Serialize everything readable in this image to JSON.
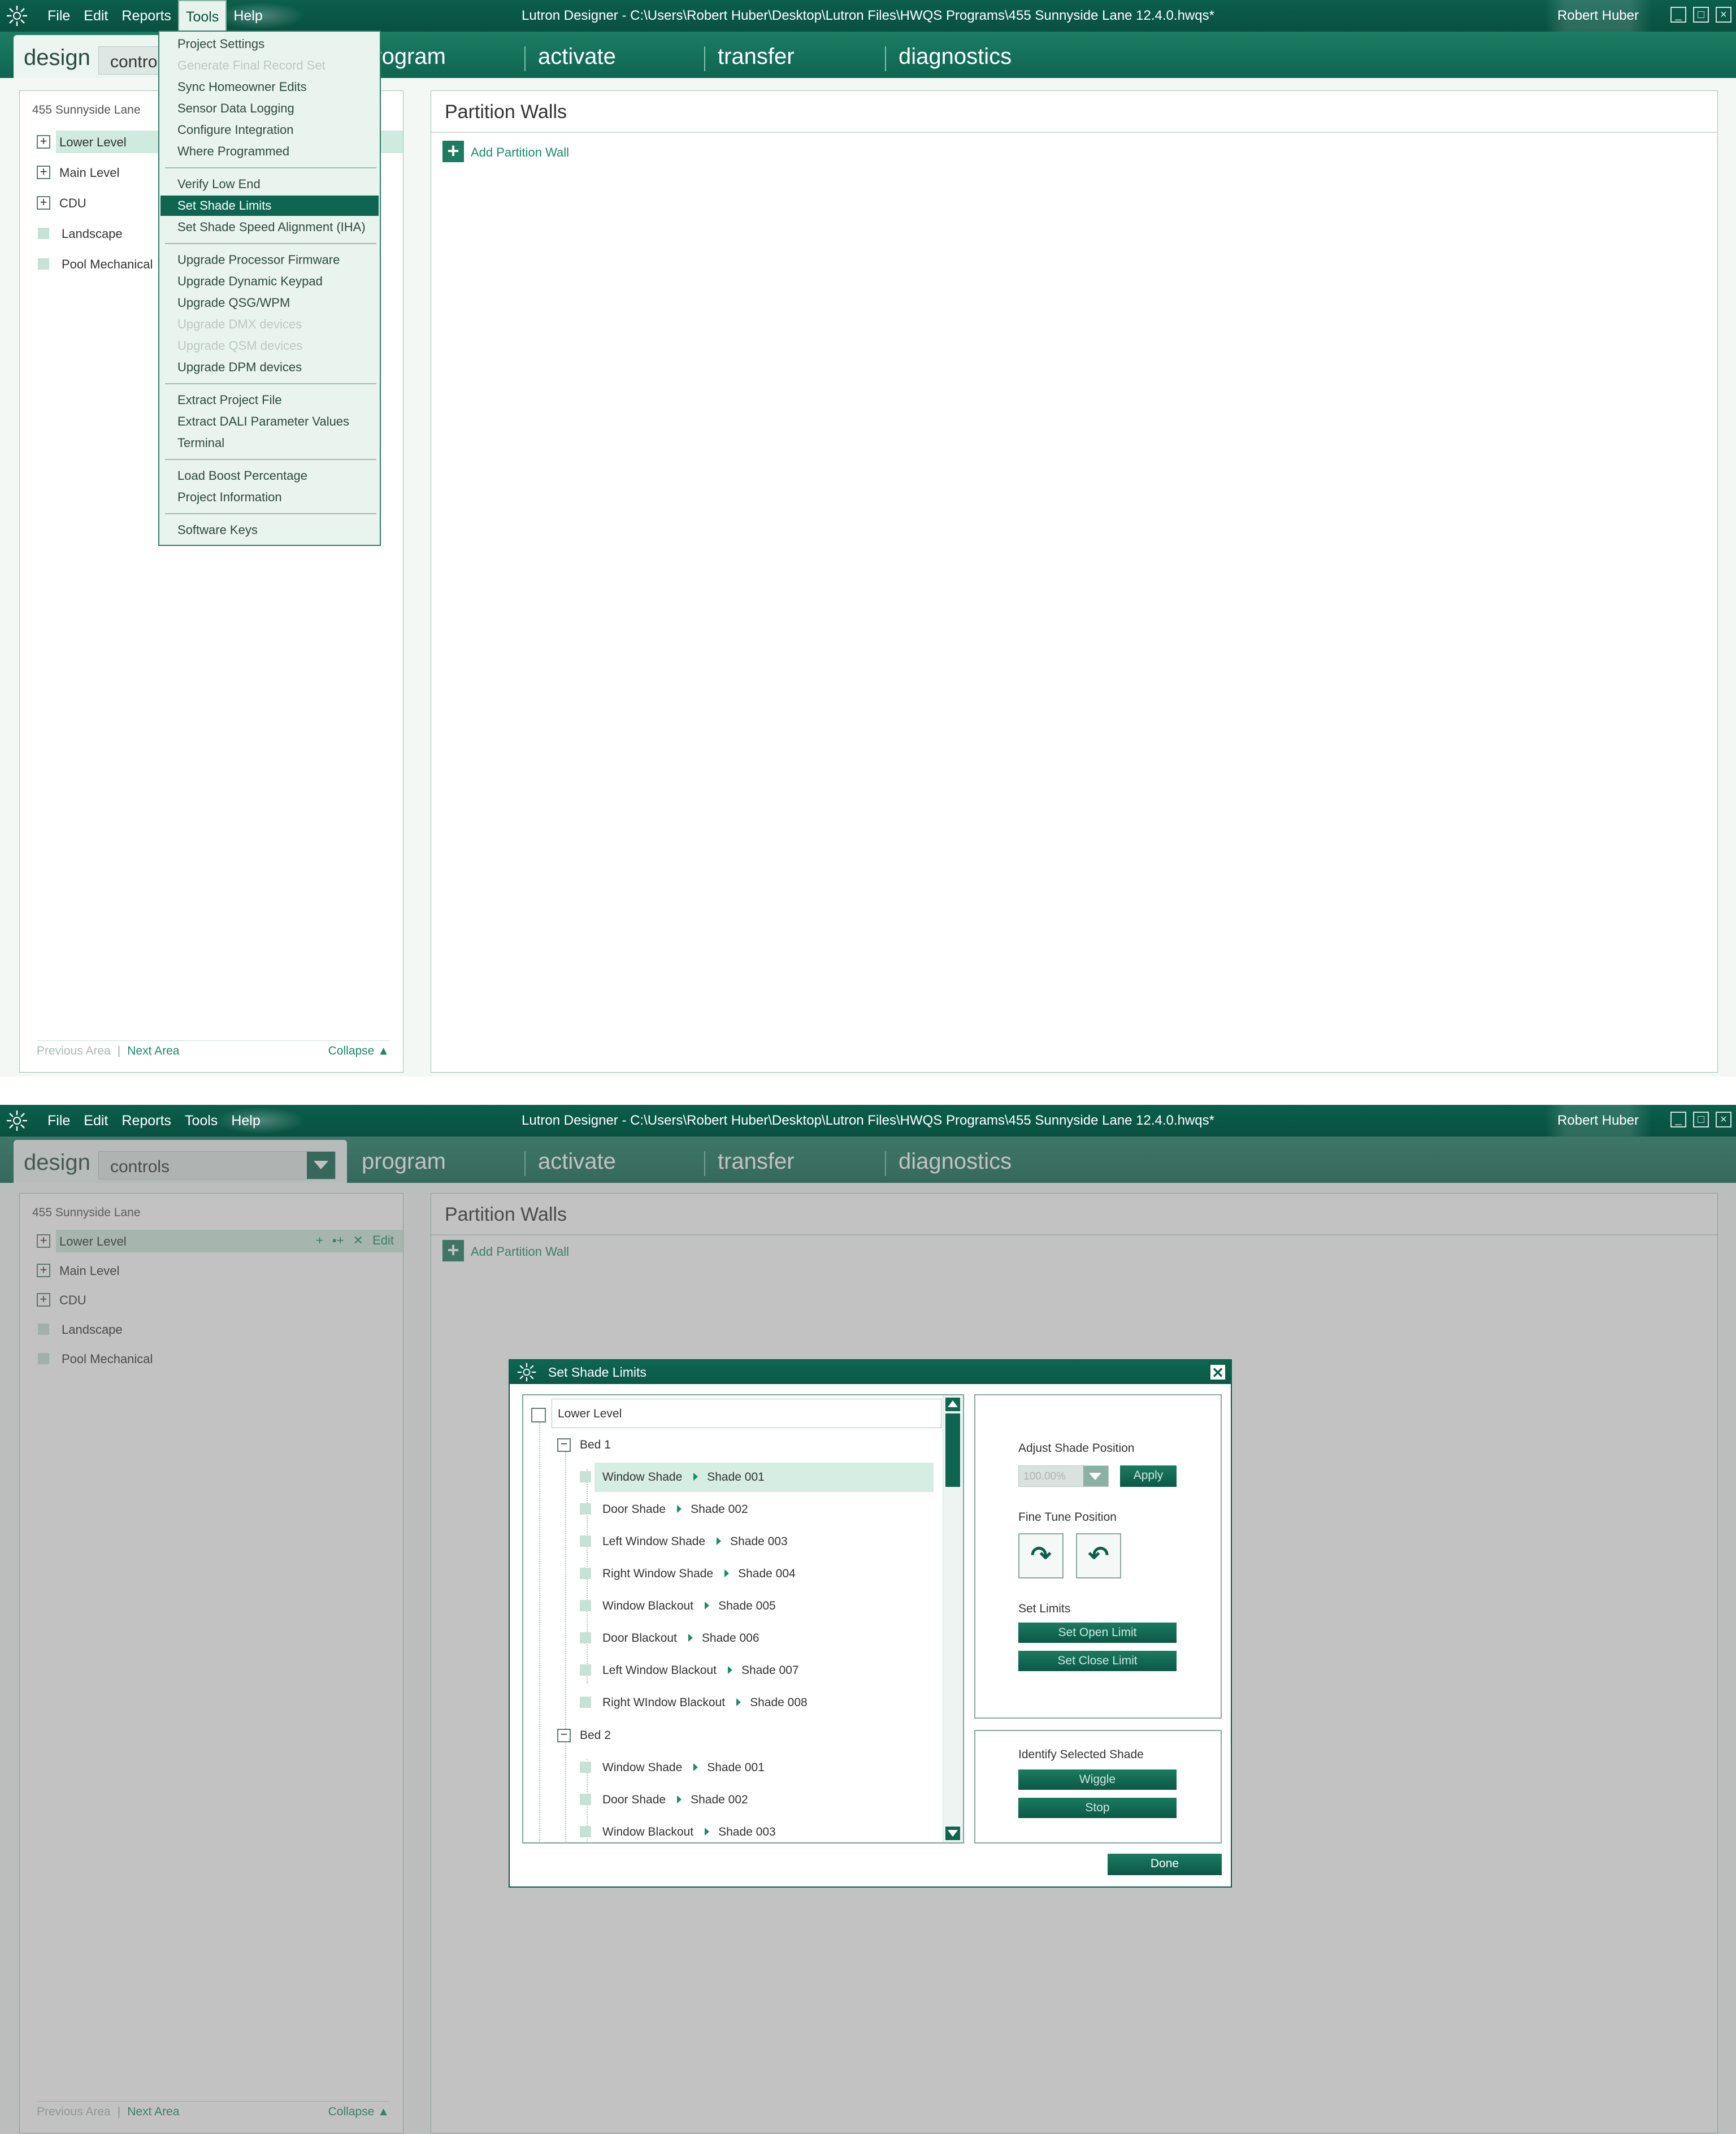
{
  "window": {
    "app_title": "Lutron Designer - C:\\Users\\Robert Huber\\Desktop\\Lutron Files\\HWQS Programs\\455 Sunnyside Lane 12.4.0.hwqs*",
    "user": "Robert Huber"
  },
  "menubar": [
    "File",
    "Edit",
    "Reports",
    "Tools",
    "Help"
  ],
  "nav": {
    "design": "design",
    "mode_value": "controls",
    "tabs": [
      "program",
      "activate",
      "transfer",
      "diagnostics"
    ]
  },
  "tree": {
    "root": "455 Sunnyside Lane",
    "items": [
      "Lower Level",
      "Main Level",
      "CDU",
      "Landscape",
      "Pool Mechanical"
    ],
    "row_edit": "Edit",
    "footer": {
      "previous": "Previous Area",
      "next": "Next Area",
      "collapse": "Collapse"
    }
  },
  "content": {
    "title": "Partition Walls",
    "add_label": "Add Partition Wall"
  },
  "tools_menu": {
    "items": [
      {
        "label": "Project Settings",
        "disabled": false,
        "highlight": false
      },
      {
        "label": "Generate Final Record Set",
        "disabled": true,
        "highlight": false
      },
      {
        "label": "Sync Homeowner Edits",
        "disabled": false,
        "highlight": false
      },
      {
        "label": "Sensor Data Logging",
        "disabled": false,
        "highlight": false
      },
      {
        "label": "Configure Integration",
        "disabled": false,
        "highlight": false
      },
      {
        "label": "Where Programmed",
        "disabled": false,
        "highlight": false
      },
      {
        "label": "Verify Low End",
        "disabled": false,
        "highlight": false
      },
      {
        "label": "Set Shade Limits",
        "disabled": false,
        "highlight": true
      },
      {
        "label": "Set Shade Speed Alignment (IHA)",
        "disabled": false,
        "highlight": false
      },
      {
        "label": "Upgrade Processor Firmware",
        "disabled": false,
        "highlight": false
      },
      {
        "label": "Upgrade Dynamic Keypad",
        "disabled": false,
        "highlight": false
      },
      {
        "label": "Upgrade QSG/WPM",
        "disabled": false,
        "highlight": false
      },
      {
        "label": "Upgrade DMX devices",
        "disabled": true,
        "highlight": false
      },
      {
        "label": "Upgrade QSM devices",
        "disabled": true,
        "highlight": false
      },
      {
        "label": "Upgrade DPM devices",
        "disabled": false,
        "highlight": false
      },
      {
        "label": "Extract Project File",
        "disabled": false,
        "highlight": false
      },
      {
        "label": "Extract DALI Parameter Values",
        "disabled": false,
        "highlight": false
      },
      {
        "label": "Terminal",
        "disabled": false,
        "highlight": false
      },
      {
        "label": "Load Boost Percentage",
        "disabled": false,
        "highlight": false
      },
      {
        "label": "Project Information",
        "disabled": false,
        "highlight": false
      },
      {
        "label": "Software Keys",
        "disabled": false,
        "highlight": false
      }
    ]
  },
  "dialog": {
    "title": "Set Shade Limits",
    "tree_root": "Lower Level",
    "rooms": [
      {
        "name": "Bed 1",
        "shades": [
          {
            "name": "Window Shade",
            "id": "Shade 001"
          },
          {
            "name": "Door Shade",
            "id": "Shade 002"
          },
          {
            "name": "Left Window Shade",
            "id": "Shade 003"
          },
          {
            "name": "Right Window Shade",
            "id": "Shade 004"
          },
          {
            "name": "Window Blackout",
            "id": "Shade 005"
          },
          {
            "name": "Door Blackout",
            "id": "Shade 006"
          },
          {
            "name": "Left Window Blackout",
            "id": "Shade 007"
          },
          {
            "name": "Right WIndow Blackout",
            "id": "Shade 008"
          }
        ]
      },
      {
        "name": "Bed 2",
        "shades": [
          {
            "name": "Window Shade",
            "id": "Shade 001"
          },
          {
            "name": "Door Shade",
            "id": "Shade 002"
          },
          {
            "name": "Window Blackout",
            "id": "Shade 003"
          }
        ]
      }
    ],
    "adjust_label": "Adjust Shade Position",
    "position_value": "100.00%",
    "apply": "Apply",
    "fine_tune_label": "Fine Tune Position",
    "set_limits_label": "Set Limits",
    "set_open": "Set Open Limit",
    "set_close": "Set Close Limit",
    "identify_label": "Identify Selected Shade",
    "wiggle": "Wiggle",
    "stop": "Stop",
    "done": "Done"
  },
  "colors": {
    "brand_dark": "#0b5f4b",
    "brand": "#0e6650",
    "accent_text": "#1a8b6a",
    "selection": "#cfeadf"
  }
}
